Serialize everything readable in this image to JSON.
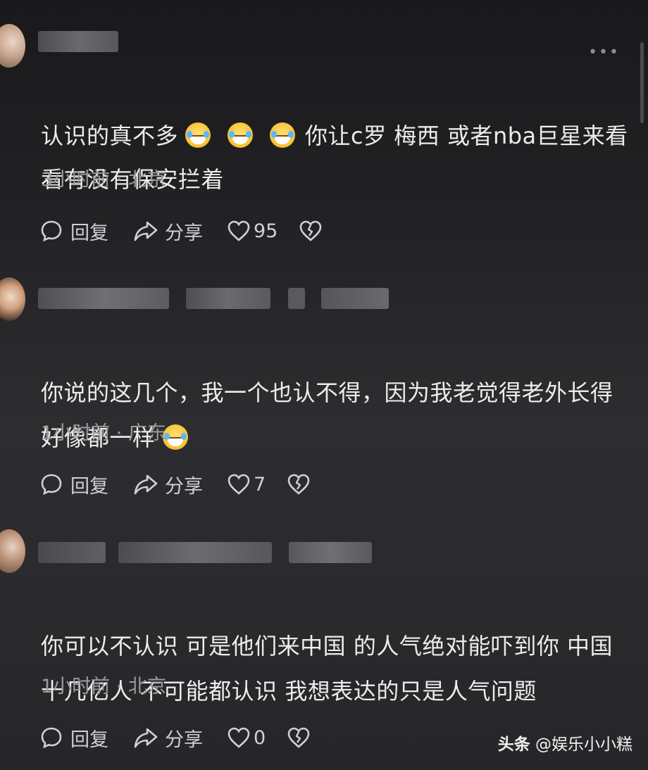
{
  "more_menu": "•••",
  "comments": [
    {
      "text_parts": [
        "认识的真不多",
        "你让c罗 梅西 或者nba巨星来看看有没有保安拦着"
      ],
      "emoji": "grinning-sweat-emoji",
      "time": "3小时前",
      "location": "北京",
      "reply_label": "回复",
      "share_label": "分享",
      "likes": "95"
    },
    {
      "text_parts": [
        "你说的这几个，我一个也认不得，因为我老觉得老外长得好像都一样",
        ""
      ],
      "emoji": "laughing-tears-emoji",
      "time": "1小时前",
      "location": "广东",
      "reply_label": "回复",
      "share_label": "分享",
      "likes": "7"
    },
    {
      "text_parts": [
        "你可以不认识 可是他们来中国 的人气绝对能吓到你 中国十几亿人 不可能都认识 我想表达的只是人气问题",
        ""
      ],
      "time": "1小时前",
      "location": "北京",
      "reply_label": "回复",
      "share_label": "分享",
      "likes": "0"
    }
  ],
  "watermark": {
    "brand": "头条",
    "account": "@娱乐小小糕"
  }
}
